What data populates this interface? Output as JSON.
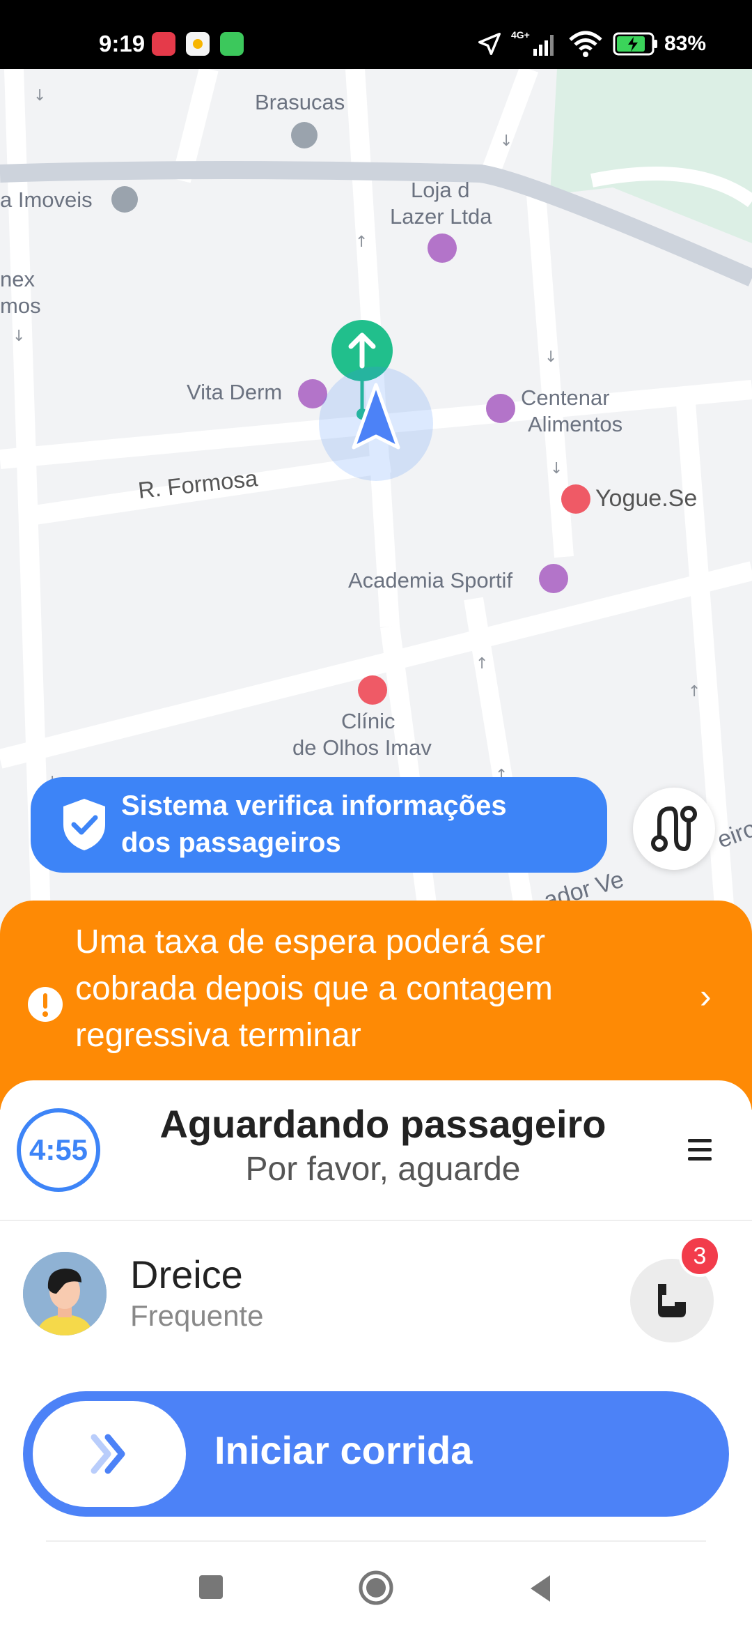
{
  "status_bar": {
    "time": "9:19",
    "network": "4G+",
    "battery_pct": "83%"
  },
  "map": {
    "labels": {
      "brasucas": "Brasucas",
      "imoveis": "a Imoveis",
      "loja1": "Loja d",
      "loja2": "Lazer Ltda",
      "nex1": "nex",
      "nex2": "mos",
      "vita": "Vita Derm",
      "centenar1": "Centenar",
      "centenar2": "Alimentos",
      "street": "R. Formosa",
      "yogue": "Yogue.Se",
      "academia": "Academia Sportif",
      "clinic1": "Clínic",
      "clinic2": "de Olhos Imav",
      "road": "ador Ve",
      "road2": "eiro"
    }
  },
  "safety_banner": {
    "line1": "Sistema verifica informações",
    "line2": "dos passageiros"
  },
  "notice": {
    "text": "Uma taxa de espera poderá ser cobrada depois que a contagem regressiva terminar"
  },
  "trip": {
    "timer": "4:55",
    "title": "Aguardando passageiro",
    "subtitle": "Por favor, aguarde"
  },
  "passenger": {
    "name": "Dreice",
    "tag": "Frequente",
    "unread_calls": "3"
  },
  "start_button": {
    "label": "Iniciar corrida"
  },
  "colors": {
    "accent_blue": "#3d84f7",
    "notice_orange": "#fe8a05",
    "badge_red": "#f23c4b",
    "nav_green": "#21bf8c",
    "poi_purple": "#b374c9"
  }
}
